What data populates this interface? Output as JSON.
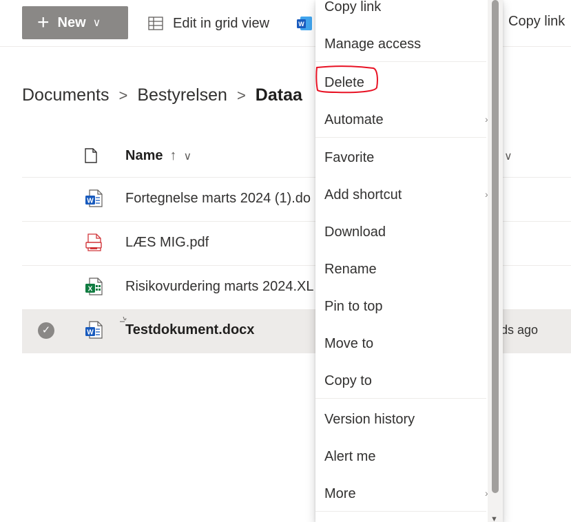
{
  "commandbar": {
    "new_label": "New",
    "new_plus": "+",
    "new_chevron": "∨",
    "grid_label": "Edit in grid view",
    "copy_link_label": "Copy link"
  },
  "breadcrumb": {
    "items": [
      "Documents",
      "Bestyrelsen"
    ],
    "current": "Dataa",
    "separator": ">"
  },
  "list": {
    "header_name": "Name",
    "sort_arrow": "↑",
    "sort_chevron": "∨",
    "modified_chevron": "∨",
    "rows": [
      {
        "name": "Fortegnelse marts 2024 (1).do",
        "icon": "word-file-icon"
      },
      {
        "name": "LÆS MIG.pdf",
        "icon": "pdf-file-icon"
      },
      {
        "name": "Risikovurdering marts 2024.XL",
        "icon": "excel-file-icon"
      },
      {
        "name": "Testdokument.docx",
        "icon": "word-file-icon",
        "selected": true,
        "modified": "ds ago"
      }
    ]
  },
  "context_menu": {
    "items": [
      {
        "label": "Copy link"
      },
      {
        "label": "Manage access"
      },
      {
        "label": "Delete",
        "annotated": true
      },
      {
        "label": "Automate",
        "submenu": true
      },
      {
        "label": "Favorite"
      },
      {
        "label": "Add shortcut",
        "submenu": true
      },
      {
        "label": "Download"
      },
      {
        "label": "Rename"
      },
      {
        "label": "Pin to top"
      },
      {
        "label": "Move to"
      },
      {
        "label": "Copy to"
      },
      {
        "label": "Version history"
      },
      {
        "label": "Alert me"
      },
      {
        "label": "More",
        "submenu": true
      }
    ],
    "submenu_glyph": "›",
    "annotation_color": "#e81123"
  },
  "colors": {
    "new_button_bg": "#8a8886",
    "selected_row_bg": "#edebe9",
    "word_blue": "#185abd",
    "excel_green": "#107c41",
    "pdf_red": "#d13438"
  }
}
